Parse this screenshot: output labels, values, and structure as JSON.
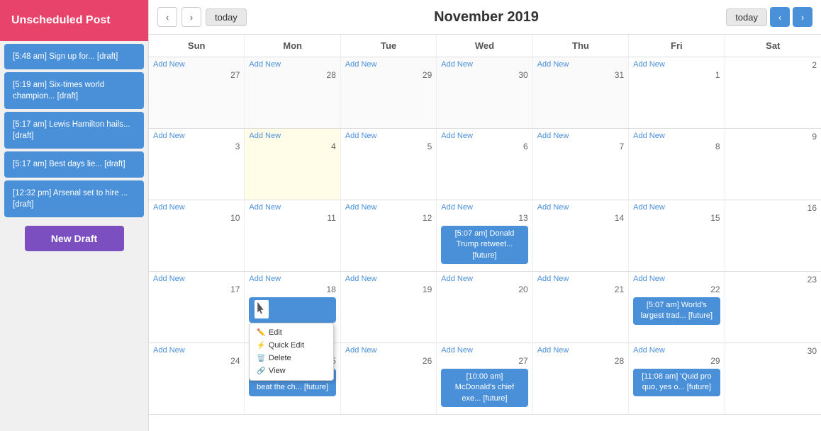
{
  "sidebar": {
    "header": "Unscheduled Post",
    "posts": [
      {
        "label": "[5:48 am] Sign up for... [draft]"
      },
      {
        "label": "[5:19 am] Six-times world champion... [draft]"
      },
      {
        "label": "[5:17 am] Lewis Hamilton hails... [draft]"
      },
      {
        "label": "[5:17 am] Best days lie... [draft]"
      },
      {
        "label": "[12:32 pm] Arsenal set to hire ... [draft]"
      }
    ],
    "new_draft_label": "New Draft"
  },
  "topnav": {
    "prev_label": "‹",
    "next_label": "›",
    "today_label": "today",
    "title": "November 2019",
    "today_right_label": "today",
    "prev_right_label": "‹",
    "next_right_label": "›"
  },
  "calendar": {
    "days_of_week": [
      "Sun",
      "Mon",
      "Tue",
      "Wed",
      "Thu",
      "Fri",
      "Sat"
    ],
    "weeks": [
      {
        "days": [
          {
            "date": 27,
            "other_month": true,
            "add_new": true,
            "events": []
          },
          {
            "date": 28,
            "other_month": true,
            "add_new": true,
            "events": []
          },
          {
            "date": 29,
            "other_month": true,
            "add_new": true,
            "events": []
          },
          {
            "date": 30,
            "other_month": true,
            "add_new": true,
            "events": []
          },
          {
            "date": 31,
            "other_month": true,
            "add_new": true,
            "events": []
          },
          {
            "date": 1,
            "other_month": false,
            "add_new": true,
            "events": []
          },
          {
            "date": 2,
            "other_month": false,
            "add_new": false,
            "events": []
          }
        ]
      },
      {
        "days": [
          {
            "date": 3,
            "other_month": false,
            "add_new": true,
            "events": []
          },
          {
            "date": 4,
            "other_month": false,
            "add_new": true,
            "today": true,
            "events": []
          },
          {
            "date": 5,
            "other_month": false,
            "add_new": true,
            "events": []
          },
          {
            "date": 6,
            "other_month": false,
            "add_new": true,
            "events": []
          },
          {
            "date": 7,
            "other_month": false,
            "add_new": true,
            "events": []
          },
          {
            "date": 8,
            "other_month": false,
            "add_new": true,
            "events": []
          },
          {
            "date": 9,
            "other_month": false,
            "add_new": false,
            "events": []
          }
        ]
      },
      {
        "days": [
          {
            "date": 10,
            "other_month": false,
            "add_new": true,
            "events": []
          },
          {
            "date": 11,
            "other_month": false,
            "add_new": true,
            "events": []
          },
          {
            "date": 12,
            "other_month": false,
            "add_new": true,
            "events": []
          },
          {
            "date": 13,
            "other_month": false,
            "add_new": true,
            "events": [
              {
                "label": "[5:07 am] Donald Trump retweet... [future]",
                "has_menu": false
              }
            ]
          },
          {
            "date": 14,
            "other_month": false,
            "add_new": true,
            "events": []
          },
          {
            "date": 15,
            "other_month": false,
            "add_new": true,
            "events": []
          },
          {
            "date": 16,
            "other_month": false,
            "add_new": false,
            "events": []
          }
        ]
      },
      {
        "days": [
          {
            "date": 17,
            "other_month": false,
            "add_new": true,
            "events": []
          },
          {
            "date": 18,
            "other_month": false,
            "add_new": true,
            "events": [
              {
                "label": "",
                "has_menu": true
              }
            ]
          },
          {
            "date": 19,
            "other_month": false,
            "add_new": true,
            "events": []
          },
          {
            "date": 20,
            "other_month": false,
            "add_new": true,
            "events": []
          },
          {
            "date": 21,
            "other_month": false,
            "add_new": true,
            "events": []
          },
          {
            "date": 22,
            "other_month": false,
            "add_new": true,
            "events": [
              {
                "label": "[5:07 am] World's largest trad... [future]",
                "has_menu": false
              }
            ]
          },
          {
            "date": 23,
            "other_month": false,
            "add_new": false,
            "events": []
          }
        ]
      },
      {
        "days": [
          {
            "date": 24,
            "other_month": false,
            "add_new": true,
            "events": []
          },
          {
            "date": 25,
            "other_month": false,
            "add_new": true,
            "events": [
              {
                "label": "[2:00 am] Wines to beat the ch... [future]",
                "has_menu": false
              }
            ]
          },
          {
            "date": 26,
            "other_month": false,
            "add_new": true,
            "events": []
          },
          {
            "date": 27,
            "other_month": false,
            "add_new": true,
            "events": [
              {
                "label": "[10:00 am] McDonald's chief exe... [future]",
                "has_menu": false
              }
            ]
          },
          {
            "date": 28,
            "other_month": false,
            "add_new": true,
            "events": []
          },
          {
            "date": 29,
            "other_month": false,
            "add_new": true,
            "events": [
              {
                "label": "[11:08 am] 'Quid pro quo, yes o... [future]",
                "has_menu": false
              }
            ]
          },
          {
            "date": 30,
            "other_month": false,
            "add_new": false,
            "events": []
          }
        ]
      }
    ],
    "context_menu": {
      "items": [
        "Edit",
        "Quick Edit",
        "Delete",
        "View"
      ],
      "icons": [
        "✏️",
        "⚡",
        "🗑️",
        "🔗"
      ]
    }
  }
}
